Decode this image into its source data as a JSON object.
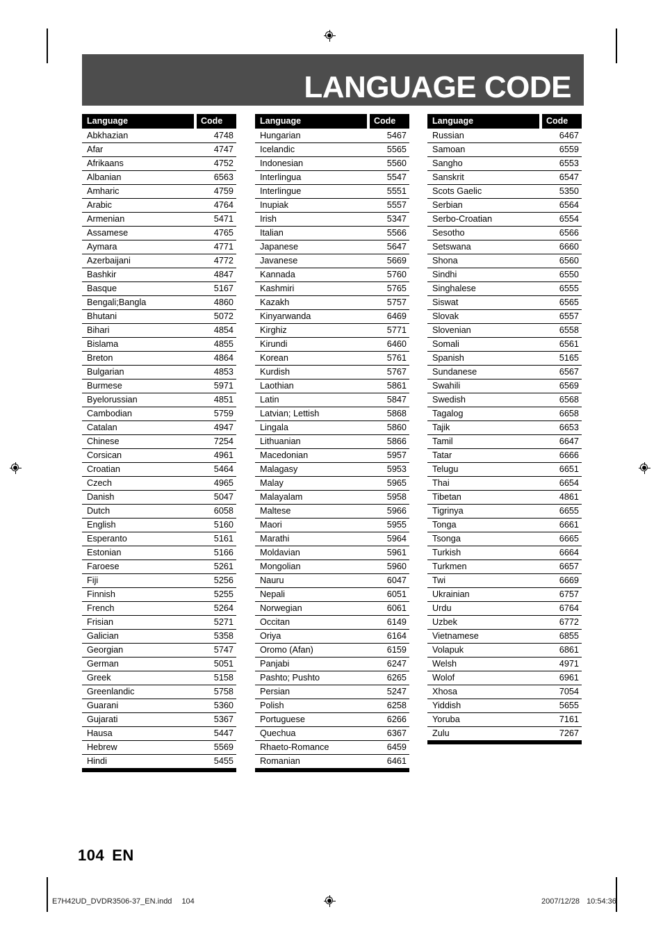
{
  "page": {
    "title": "LANGUAGE CODE",
    "number": "104",
    "language_code": "EN"
  },
  "table": {
    "headers": {
      "language": "Language",
      "code": "Code"
    },
    "columns": [
      {
        "rows": [
          {
            "language": "Abkhazian",
            "code": "4748"
          },
          {
            "language": "Afar",
            "code": "4747"
          },
          {
            "language": "Afrikaans",
            "code": "4752"
          },
          {
            "language": "Albanian",
            "code": "6563"
          },
          {
            "language": "Amharic",
            "code": "4759"
          },
          {
            "language": "Arabic",
            "code": "4764"
          },
          {
            "language": "Armenian",
            "code": "5471"
          },
          {
            "language": "Assamese",
            "code": "4765"
          },
          {
            "language": "Aymara",
            "code": "4771"
          },
          {
            "language": "Azerbaijani",
            "code": "4772"
          },
          {
            "language": "Bashkir",
            "code": "4847"
          },
          {
            "language": "Basque",
            "code": "5167"
          },
          {
            "language": "Bengali;Bangla",
            "code": "4860"
          },
          {
            "language": "Bhutani",
            "code": "5072"
          },
          {
            "language": "Bihari",
            "code": "4854"
          },
          {
            "language": "Bislama",
            "code": "4855"
          },
          {
            "language": "Breton",
            "code": "4864"
          },
          {
            "language": "Bulgarian",
            "code": "4853"
          },
          {
            "language": "Burmese",
            "code": "5971"
          },
          {
            "language": "Byelorussian",
            "code": "4851"
          },
          {
            "language": "Cambodian",
            "code": "5759"
          },
          {
            "language": "Catalan",
            "code": "4947"
          },
          {
            "language": "Chinese",
            "code": "7254"
          },
          {
            "language": "Corsican",
            "code": "4961"
          },
          {
            "language": "Croatian",
            "code": "5464"
          },
          {
            "language": "Czech",
            "code": "4965"
          },
          {
            "language": "Danish",
            "code": "5047"
          },
          {
            "language": "Dutch",
            "code": "6058"
          },
          {
            "language": "English",
            "code": "5160"
          },
          {
            "language": "Esperanto",
            "code": "5161"
          },
          {
            "language": "Estonian",
            "code": "5166"
          },
          {
            "language": "Faroese",
            "code": "5261"
          },
          {
            "language": "Fiji",
            "code": "5256"
          },
          {
            "language": "Finnish",
            "code": "5255"
          },
          {
            "language": "French",
            "code": "5264"
          },
          {
            "language": "Frisian",
            "code": "5271"
          },
          {
            "language": "Galician",
            "code": "5358"
          },
          {
            "language": "Georgian",
            "code": "5747"
          },
          {
            "language": "German",
            "code": "5051"
          },
          {
            "language": "Greek",
            "code": "5158"
          },
          {
            "language": "Greenlandic",
            "code": "5758"
          },
          {
            "language": "Guarani",
            "code": "5360"
          },
          {
            "language": "Gujarati",
            "code": "5367"
          },
          {
            "language": "Hausa",
            "code": "5447"
          },
          {
            "language": "Hebrew",
            "code": "5569"
          },
          {
            "language": "Hindi",
            "code": "5455"
          }
        ]
      },
      {
        "rows": [
          {
            "language": "Hungarian",
            "code": "5467"
          },
          {
            "language": "Icelandic",
            "code": "5565"
          },
          {
            "language": "Indonesian",
            "code": "5560"
          },
          {
            "language": "Interlingua",
            "code": "5547"
          },
          {
            "language": "Interlingue",
            "code": "5551"
          },
          {
            "language": "Inupiak",
            "code": "5557"
          },
          {
            "language": "Irish",
            "code": "5347"
          },
          {
            "language": "Italian",
            "code": "5566"
          },
          {
            "language": "Japanese",
            "code": "5647"
          },
          {
            "language": "Javanese",
            "code": "5669"
          },
          {
            "language": "Kannada",
            "code": "5760"
          },
          {
            "language": "Kashmiri",
            "code": "5765"
          },
          {
            "language": "Kazakh",
            "code": "5757"
          },
          {
            "language": "Kinyarwanda",
            "code": "6469"
          },
          {
            "language": "Kirghiz",
            "code": "5771"
          },
          {
            "language": "Kirundi",
            "code": "6460"
          },
          {
            "language": "Korean",
            "code": "5761"
          },
          {
            "language": "Kurdish",
            "code": "5767"
          },
          {
            "language": "Laothian",
            "code": "5861"
          },
          {
            "language": "Latin",
            "code": "5847"
          },
          {
            "language": "Latvian; Lettish",
            "code": "5868"
          },
          {
            "language": "Lingala",
            "code": "5860"
          },
          {
            "language": "Lithuanian",
            "code": "5866"
          },
          {
            "language": "Macedonian",
            "code": "5957"
          },
          {
            "language": "Malagasy",
            "code": "5953"
          },
          {
            "language": "Malay",
            "code": "5965"
          },
          {
            "language": "Malayalam",
            "code": "5958"
          },
          {
            "language": "Maltese",
            "code": "5966"
          },
          {
            "language": "Maori",
            "code": "5955"
          },
          {
            "language": "Marathi",
            "code": "5964"
          },
          {
            "language": "Moldavian",
            "code": "5961"
          },
          {
            "language": "Mongolian",
            "code": "5960"
          },
          {
            "language": "Nauru",
            "code": "6047"
          },
          {
            "language": "Nepali",
            "code": "6051"
          },
          {
            "language": "Norwegian",
            "code": "6061"
          },
          {
            "language": "Occitan",
            "code": "6149"
          },
          {
            "language": "Oriya",
            "code": "6164"
          },
          {
            "language": "Oromo (Afan)",
            "code": "6159"
          },
          {
            "language": "Panjabi",
            "code": "6247"
          },
          {
            "language": "Pashto; Pushto",
            "code": "6265"
          },
          {
            "language": "Persian",
            "code": "5247"
          },
          {
            "language": "Polish",
            "code": "6258"
          },
          {
            "language": "Portuguese",
            "code": "6266"
          },
          {
            "language": "Quechua",
            "code": "6367"
          },
          {
            "language": "Rhaeto-Romance",
            "code": "6459"
          },
          {
            "language": "Romanian",
            "code": "6461"
          }
        ]
      },
      {
        "rows": [
          {
            "language": "Russian",
            "code": "6467"
          },
          {
            "language": "Samoan",
            "code": "6559"
          },
          {
            "language": "Sangho",
            "code": "6553"
          },
          {
            "language": "Sanskrit",
            "code": "6547"
          },
          {
            "language": "Scots Gaelic",
            "code": "5350"
          },
          {
            "language": "Serbian",
            "code": "6564"
          },
          {
            "language": "Serbo-Croatian",
            "code": "6554"
          },
          {
            "language": "Sesotho",
            "code": "6566"
          },
          {
            "language": "Setswana",
            "code": "6660"
          },
          {
            "language": "Shona",
            "code": "6560"
          },
          {
            "language": "Sindhi",
            "code": "6550"
          },
          {
            "language": "Singhalese",
            "code": "6555"
          },
          {
            "language": "Siswat",
            "code": "6565"
          },
          {
            "language": "Slovak",
            "code": "6557"
          },
          {
            "language": "Slovenian",
            "code": "6558"
          },
          {
            "language": "Somali",
            "code": "6561"
          },
          {
            "language": "Spanish",
            "code": "5165"
          },
          {
            "language": "Sundanese",
            "code": "6567"
          },
          {
            "language": "Swahili",
            "code": "6569"
          },
          {
            "language": "Swedish",
            "code": "6568"
          },
          {
            "language": "Tagalog",
            "code": "6658"
          },
          {
            "language": "Tajik",
            "code": "6653"
          },
          {
            "language": "Tamil",
            "code": "6647"
          },
          {
            "language": "Tatar",
            "code": "6666"
          },
          {
            "language": "Telugu",
            "code": "6651"
          },
          {
            "language": "Thai",
            "code": "6654"
          },
          {
            "language": "Tibetan",
            "code": "4861"
          },
          {
            "language": "Tigrinya",
            "code": "6655"
          },
          {
            "language": "Tonga",
            "code": "6661"
          },
          {
            "language": "Tsonga",
            "code": "6665"
          },
          {
            "language": "Turkish",
            "code": "6664"
          },
          {
            "language": "Turkmen",
            "code": "6657"
          },
          {
            "language": "Twi",
            "code": "6669"
          },
          {
            "language": "Ukrainian",
            "code": "6757"
          },
          {
            "language": "Urdu",
            "code": "6764"
          },
          {
            "language": "Uzbek",
            "code": "6772"
          },
          {
            "language": "Vietnamese",
            "code": "6855"
          },
          {
            "language": "Volapuk",
            "code": "6861"
          },
          {
            "language": "Welsh",
            "code": "4971"
          },
          {
            "language": "Wolof",
            "code": "6961"
          },
          {
            "language": "Xhosa",
            "code": "7054"
          },
          {
            "language": "Yiddish",
            "code": "5655"
          },
          {
            "language": "Yoruba",
            "code": "7161"
          },
          {
            "language": "Zulu",
            "code": "7267"
          }
        ]
      }
    ]
  },
  "print_footer": {
    "file_name": "E7H42UD_DVDR3506-37_EN.indd",
    "page_ref": "104",
    "date": "2007/12/28",
    "time": "10:54:36"
  },
  "colors": {
    "title_band": "#4d4d4d",
    "table_header": "#000000",
    "page_background": "#ffffff",
    "text": "#000000"
  }
}
